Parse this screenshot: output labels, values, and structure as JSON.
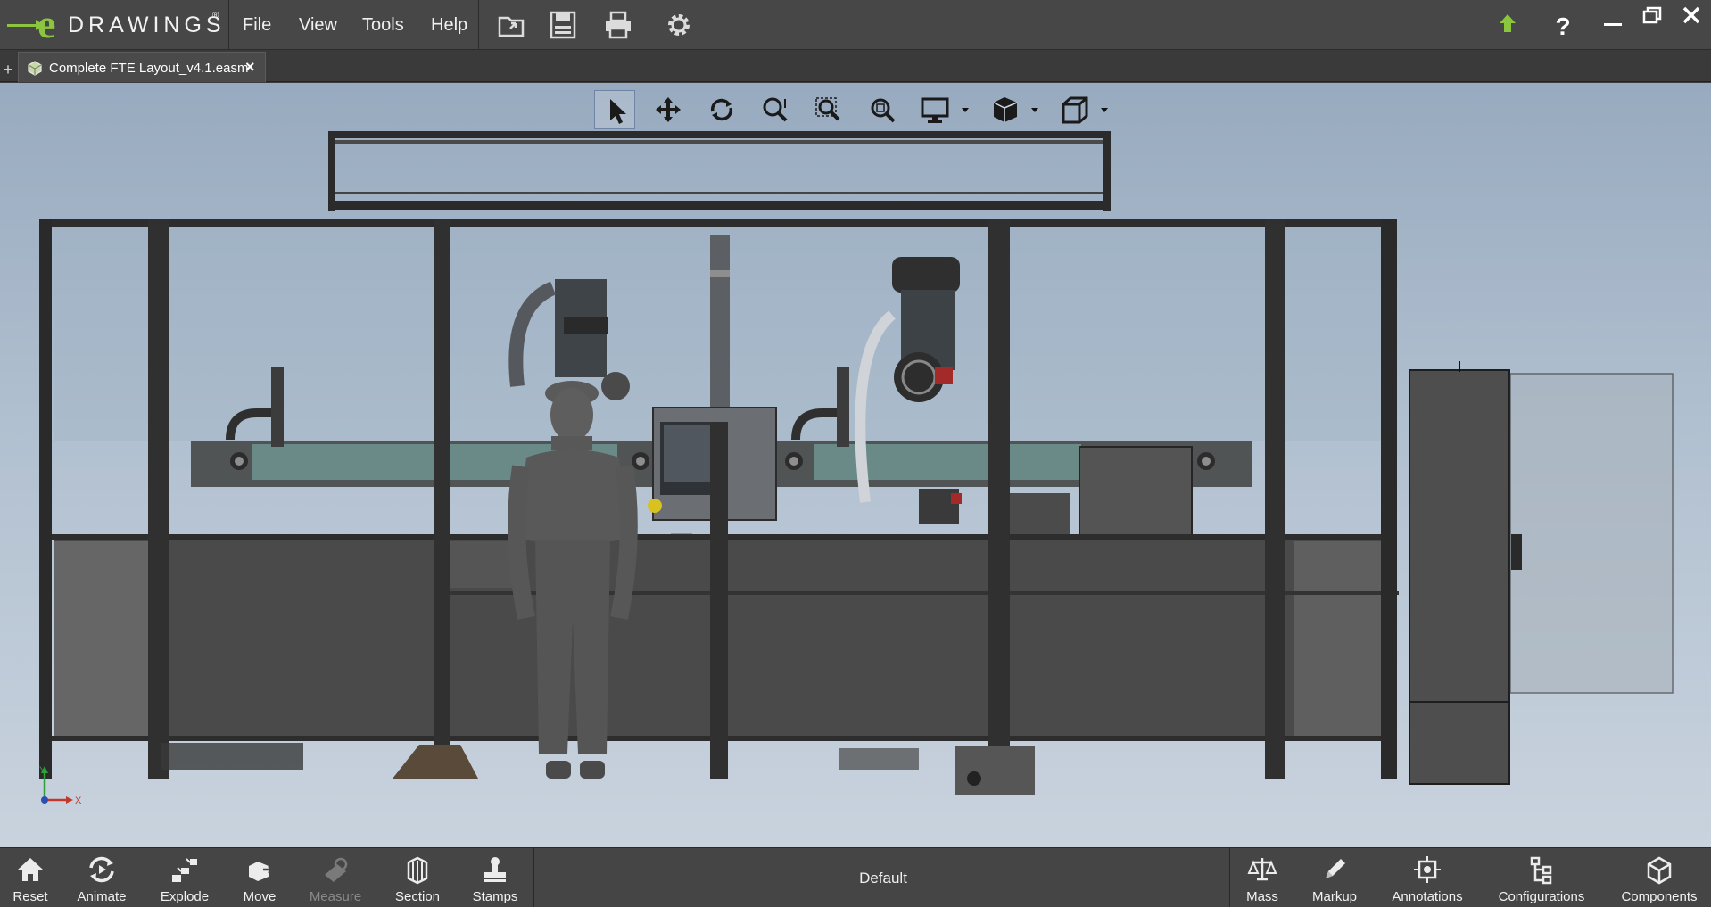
{
  "app": {
    "logo_text": "DRAWINGS",
    "logo_letter": "e",
    "logo_mark": "®"
  },
  "menu": {
    "file": "File",
    "view": "View",
    "tools": "Tools",
    "help": "Help"
  },
  "toolbar_icons": [
    "open-icon",
    "save-icon",
    "print-icon",
    "settings-icon"
  ],
  "window_controls": [
    "upload-icon",
    "help-icon",
    "minimize-icon",
    "restore-icon",
    "close-icon"
  ],
  "tabs": [
    {
      "label": "Complete FTE Layout_v4.1.easm",
      "close": "×"
    }
  ],
  "heads_up_toolbar": [
    "select-icon",
    "pan-icon",
    "rotate-icon",
    "zoom-icon",
    "zoom-area-icon",
    "zoom-fit-icon",
    "display-icon",
    "view-orientation-icon",
    "standard-views-icon"
  ],
  "triad": {
    "x_label": "X",
    "y_label": "Y"
  },
  "bottom_toolbar": {
    "left": [
      {
        "label": "Reset",
        "icon": "home-icon"
      },
      {
        "label": "Animate",
        "icon": "animate-icon"
      },
      {
        "label": "Explode",
        "icon": "explode-icon"
      },
      {
        "label": "Move",
        "icon": "move-icon"
      },
      {
        "label": "Measure",
        "icon": "measure-icon",
        "enabled": false
      },
      {
        "label": "Section",
        "icon": "section-icon"
      },
      {
        "label": "Stamps",
        "icon": "stamps-icon"
      }
    ],
    "configuration": "Default",
    "right": [
      {
        "label": "Mass",
        "icon": "mass-icon"
      },
      {
        "label": "Markup",
        "icon": "markup-icon"
      },
      {
        "label": "Annotations",
        "icon": "annotations-icon"
      },
      {
        "label": "Configurations",
        "icon": "configurations-icon"
      },
      {
        "label": "Components",
        "icon": "components-icon"
      }
    ]
  },
  "colors": {
    "accent_green": "#8cc63f",
    "chrome_dark": "#474747",
    "viewport_top": "#98aabf",
    "viewport_bottom": "#c9d3de"
  }
}
